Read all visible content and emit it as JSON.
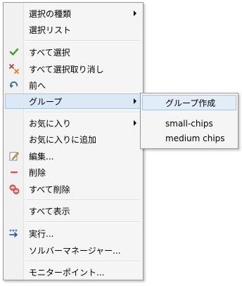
{
  "menu": {
    "items": [
      {
        "label": "選択の種類"
      },
      {
        "label": "選択リスト"
      },
      {
        "label": "すべて選択",
        "icon": "check-icon"
      },
      {
        "label": "すべて選択取り消し",
        "icon": "deselect-x-icon"
      },
      {
        "label": "前へ",
        "icon": "undo-arrow-icon"
      },
      {
        "label": "グループ"
      },
      {
        "label": "お気に入り"
      },
      {
        "label": "お気に入りに追加"
      },
      {
        "label": "編集...",
        "icon": "edit-icon"
      },
      {
        "label": "削除",
        "icon": "minus-icon"
      },
      {
        "label": "すべて削除",
        "icon": "delete-all-icon"
      },
      {
        "label": "すべて表示"
      },
      {
        "label": "実行...",
        "icon": "run-icon"
      },
      {
        "label": "ソルバーマネージャー..."
      },
      {
        "label": "モニターポイント..."
      }
    ]
  },
  "submenu": {
    "items": [
      {
        "label": "グループ作成"
      },
      {
        "label": "small-chips"
      },
      {
        "label": "medium chips"
      }
    ]
  },
  "colors": {
    "highlight_bg": "#dbe8f5",
    "highlight_border": "#a9c4e2",
    "check_green": "#3a9a2a",
    "delete_red": "#d9534f"
  }
}
